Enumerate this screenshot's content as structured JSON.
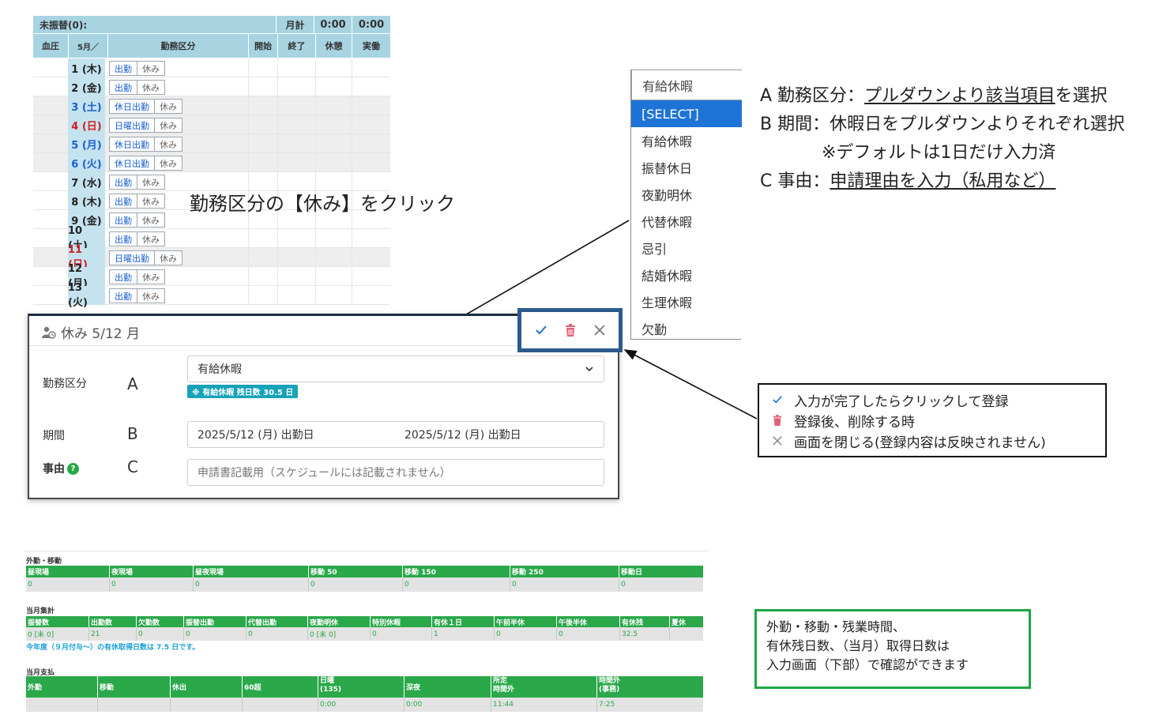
{
  "calendar": {
    "header_row1": {
      "label": "未振替(0):",
      "month_total": "月計",
      "v1": "0:00",
      "v2": "0:00"
    },
    "header_row2": {
      "c0": "血圧",
      "c1": "5月／",
      "c2": "勤務区分",
      "c3": "開始",
      "c4": "終了",
      "c5": "休憩",
      "c6": "実働"
    },
    "rows": [
      {
        "date": "1 (木)",
        "kind": "wd",
        "a": "出勤",
        "b": "休み"
      },
      {
        "date": "2 (金)",
        "kind": "wd",
        "a": "出勤",
        "b": "休み"
      },
      {
        "date": "3 (土)",
        "kind": "sat",
        "a": "休日出勤",
        "b": "休み"
      },
      {
        "date": "4 (日)",
        "kind": "sun",
        "a": "日曜出勤",
        "b": "休み"
      },
      {
        "date": "5 (月)",
        "kind": "hol",
        "a": "休日出勤",
        "b": "休み"
      },
      {
        "date": "6 (火)",
        "kind": "hol",
        "a": "休日出勤",
        "b": "休み"
      },
      {
        "date": "7 (水)",
        "kind": "wd",
        "a": "出勤",
        "b": "休み"
      },
      {
        "date": "8 (木)",
        "kind": "wd",
        "a": "出勤",
        "b": "休み"
      },
      {
        "date": "9 (金)",
        "kind": "wd",
        "a": "出勤",
        "b": "休み"
      },
      {
        "date": "10 (土)",
        "kind": "wd",
        "a": "出勤",
        "b": "休み"
      },
      {
        "date": "11 (日)",
        "kind": "sun",
        "a": "日曜出勤",
        "b": "休み"
      },
      {
        "date": "12 (月)",
        "kind": "wd",
        "a": "出勤",
        "b": "休み"
      },
      {
        "date": "13 (火)",
        "kind": "wd",
        "a": "出勤",
        "b": "休み"
      }
    ]
  },
  "click_hint": "勤務区分の【休み】をクリック",
  "dropdown": {
    "current": "有給休暇",
    "options": [
      "[SELECT]",
      "有給休暇",
      "振替休日",
      "夜勤明休",
      "代替休暇",
      "忌引",
      "結婚休暇",
      "生理休暇",
      "欠勤"
    ],
    "selected_index": 0
  },
  "instructions": {
    "a_prefix": "A 勤務区分：",
    "a_u": "プルダウンより該当項目",
    "a_suffix": "を選択",
    "b": "B 期間：休暇日をプルダウンよりそれぞれ選択",
    "b_note": "※デフォルトは1日だけ入力済",
    "c_prefix": "C 事由：",
    "c_u": "申請理由を入力（私用など）"
  },
  "modal": {
    "title": "休み 5/12 月",
    "label_type": "勤務区分",
    "letter_a": "A",
    "type_value": "有給休暇",
    "badge": "※ 有給休暇 残日数 30.5 日",
    "label_period": "期間",
    "letter_b": "B",
    "period_from": "2025/5/12 (月) 出勤日",
    "period_to": "2025/5/12 (月) 出勤日",
    "label_reason": "事由",
    "letter_c": "C",
    "reason_placeholder": "申請書記載用（スケジュールには記載されません）"
  },
  "legend": {
    "confirm": "入力が完了したらクリックして登録",
    "delete": "登録後、削除する時",
    "close": "画面を閉じる(登録内容は反映されません)"
  },
  "note": {
    "line1": "外勤・移動・残業時間、",
    "line2": "有休残日数、（当月）取得日数は",
    "line3": "入力画面（下部）で確認ができます"
  },
  "summary": {
    "outside": {
      "title": "外勤・移動",
      "headers": [
        "昼現場",
        "夜現場",
        "昼夜現場",
        "移動 50",
        "移動 150",
        "移動 250",
        "移動日"
      ],
      "values": [
        "0",
        "0",
        "0",
        "0",
        "0",
        "0",
        "0"
      ]
    },
    "monthly": {
      "title": "当月集計",
      "headers": [
        "振替数",
        "出勤数",
        "欠勤数",
        "振替出勤",
        "代替出勤",
        "夜勤明休",
        "特別休暇",
        "有休１日",
        "午前半休",
        "午後半休",
        "有休残",
        "夏休"
      ],
      "values": [
        "0 [未 0]",
        "21",
        "0",
        "0",
        "0",
        "0 [未 0]",
        "0",
        "1",
        "0",
        "0",
        "32.5",
        ""
      ],
      "year_note": "今年度（９月付与～）の有休取得日数は 7.5 日です。"
    },
    "payment": {
      "title": "当月支払",
      "headers": [
        "外勤",
        "移動",
        "休出",
        "60超",
        "日曜\n(135)",
        "深夜",
        "所定\n時間外",
        "時間外\n(事務)"
      ],
      "values": [
        "",
        "",
        "",
        "",
        "0:00",
        "0:00",
        "11:44",
        "7:25"
      ]
    }
  },
  "colors": {
    "accent_blue": "#1e74d6",
    "header_teal": "#a8d4e2",
    "table_green": "#2aa84a",
    "note_border": "#1fa646",
    "delete_red": "#e0607a"
  }
}
